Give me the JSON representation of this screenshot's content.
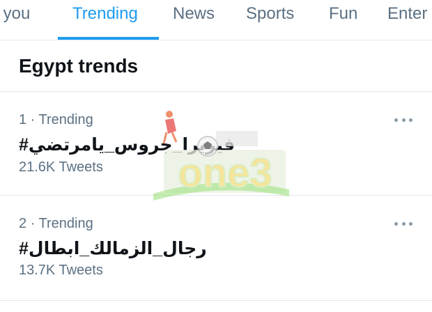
{
  "tabs": [
    {
      "label": "r you"
    },
    {
      "label": "Trending"
    },
    {
      "label": "News"
    },
    {
      "label": "Sports"
    },
    {
      "label": "Fun"
    },
    {
      "label": "Enter"
    }
  ],
  "active_tab": "Trending",
  "section_title": "Egypt trends",
  "trends": [
    {
      "meta": "1 · Trending",
      "name": "#فيريرا_جروس_يامرتضي",
      "count": "21.6K Tweets"
    },
    {
      "meta": "2 · Trending",
      "name": "#رجال_الزمالك_ابطال",
      "count": "13.7K Tweets"
    }
  ],
  "watermark": {
    "text": "one3"
  },
  "colors": {
    "accent": "#1d9bf0",
    "muted": "#5b7083",
    "text": "#0f1419",
    "divider": "#e1e8ed"
  },
  "icons": {
    "more": "more-horizontal-icon",
    "ball": "soccer-ball-icon"
  }
}
